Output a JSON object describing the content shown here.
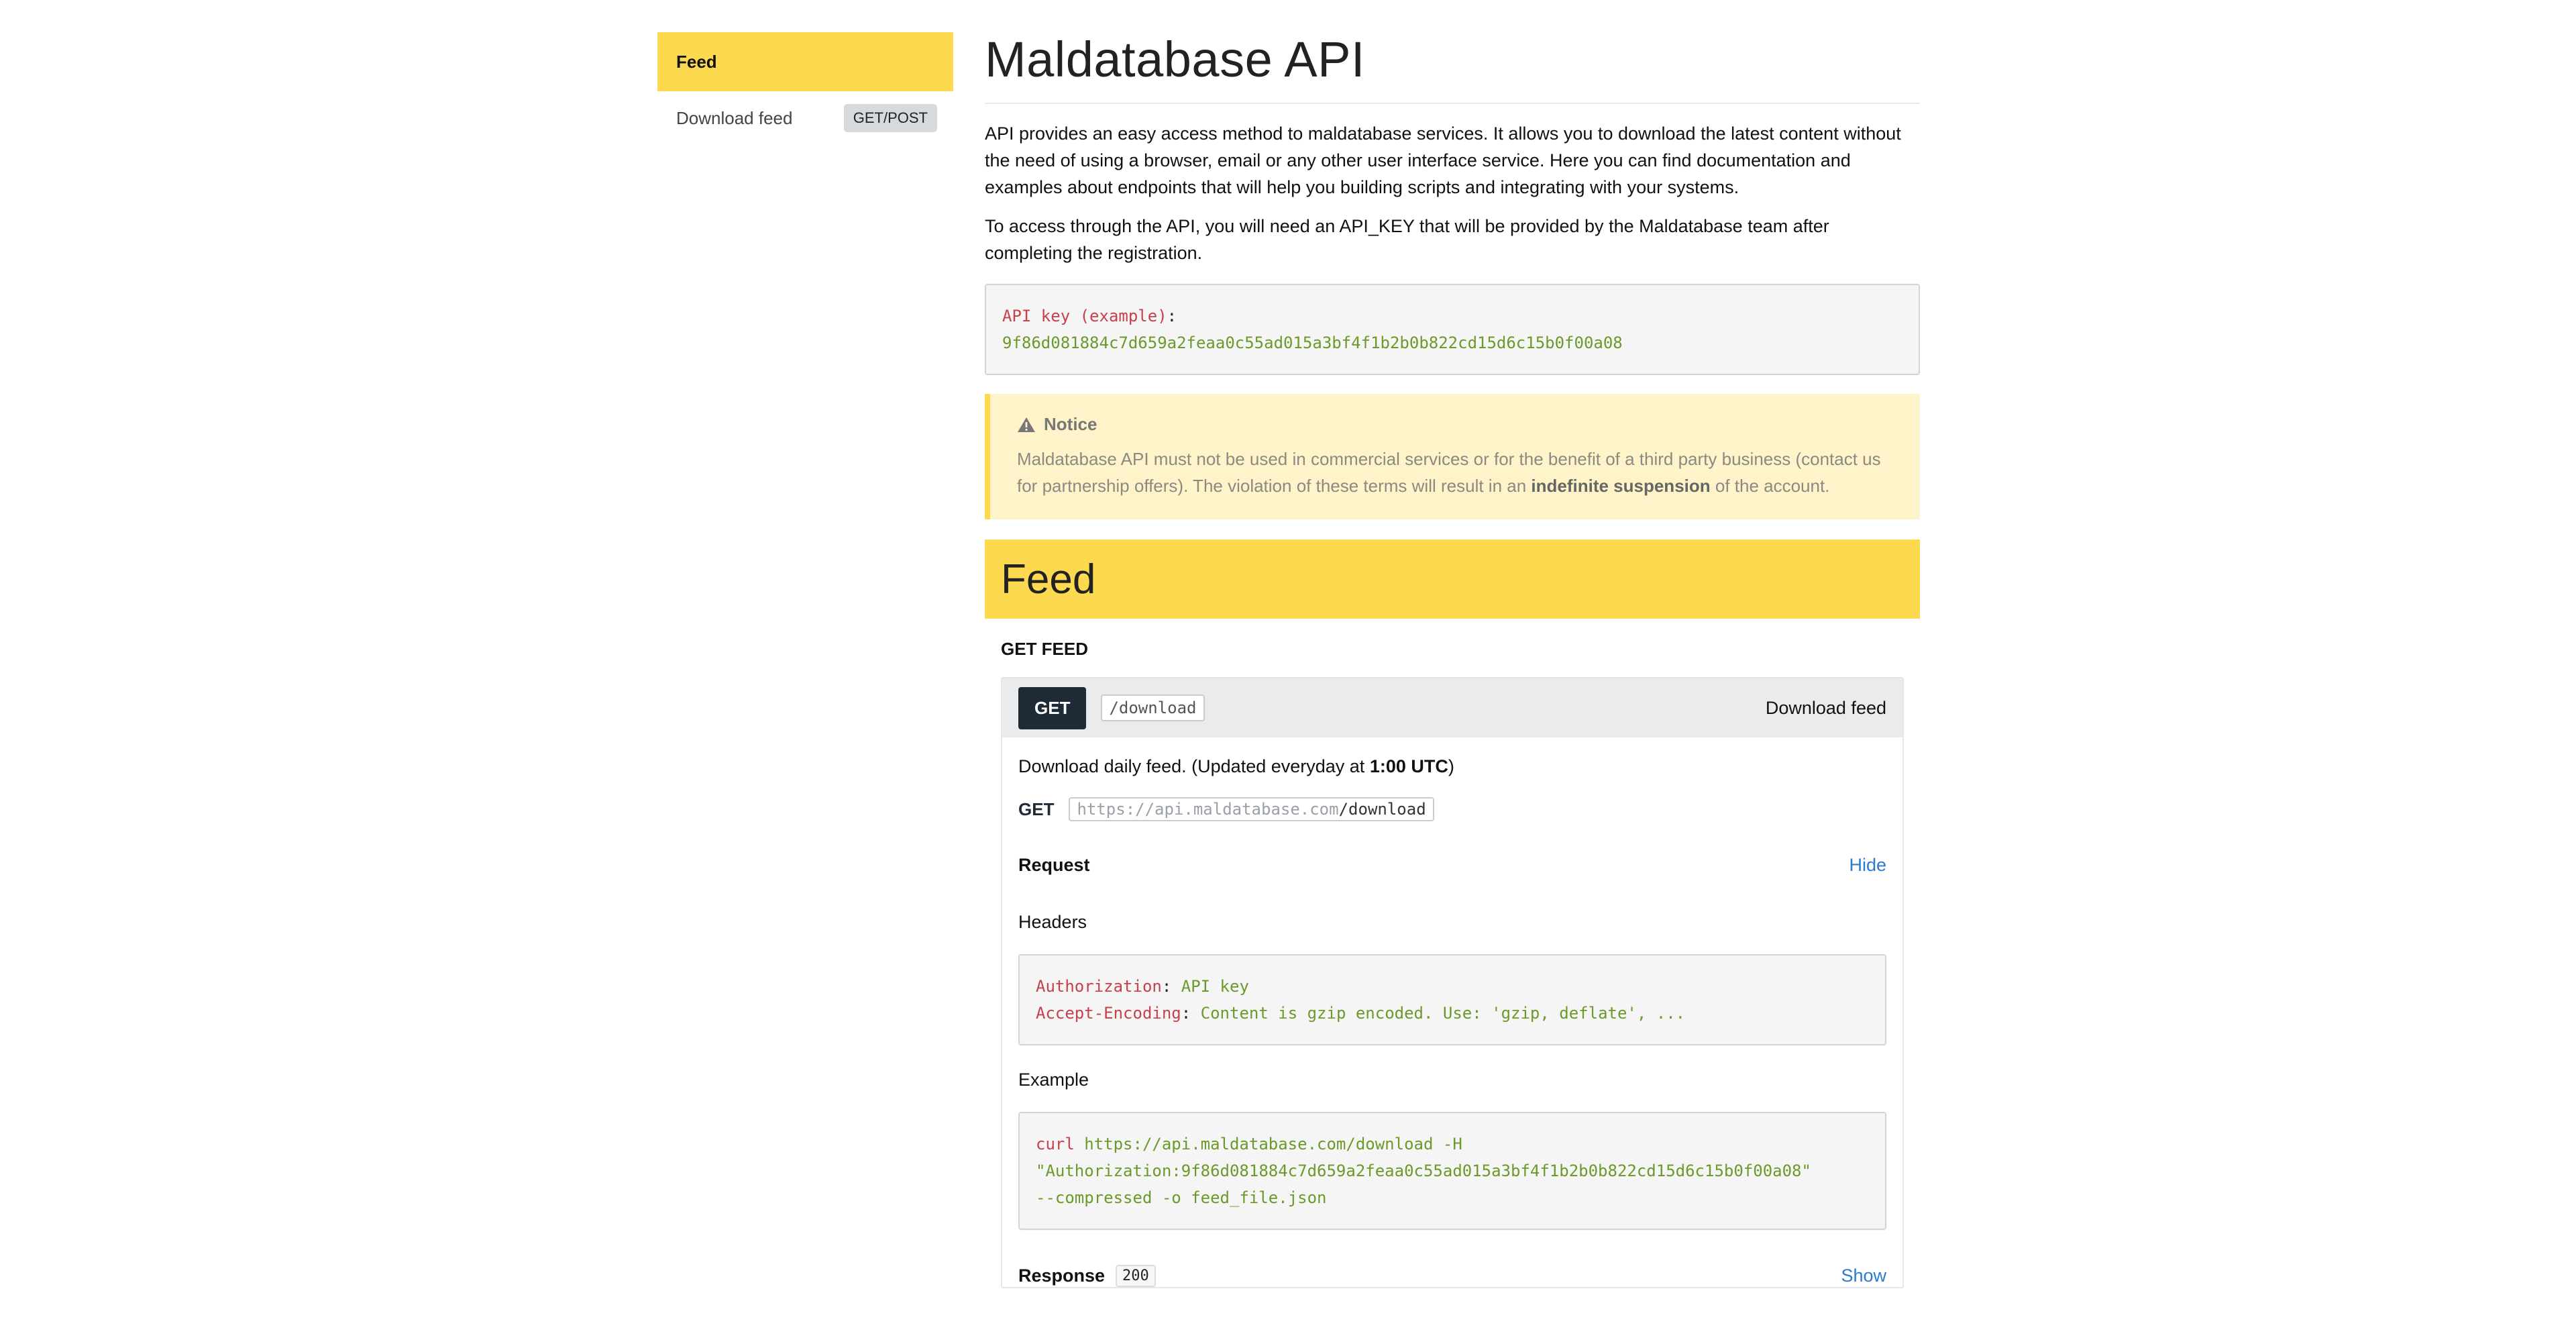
{
  "sidebar": {
    "active": "Feed",
    "items": [
      {
        "label": "Download feed",
        "badge": "GET/POST"
      }
    ]
  },
  "main": {
    "title": "Maldatabase API",
    "intro": "API provides an easy access method to maldatabase services. It allows you to download the latest content without the need of using a browser, email or any other user interface service. Here you can find documentation and examples about endpoints that will help you building scripts and integrating with your systems.",
    "access": "To access through the API, you will need an API_KEY that will be provided by the Maldatabase team after completing the registration.",
    "api_key_block": {
      "key": "API key (example)",
      "punct": ":",
      "value": "9f86d081884c7d659a2feaa0c55ad015a3bf4f1b2b0b822cd15d6c15b0f00a08"
    },
    "notice": {
      "title": "Notice",
      "text_before": "Maldatabase API must not be used in commercial services or for the benefit of a third party business (contact us for partnership offers). The violation of these terms will result in an ",
      "text_bold": "indefinite suspension",
      "text_after": " of the account."
    },
    "section": {
      "title": "Feed",
      "subtitle": "GET FEED",
      "endpoint": {
        "method": "GET",
        "path": "/download",
        "name": "Download feed",
        "desc_before": "Download daily feed. (Updated everyday at ",
        "desc_bold": "1:00 UTC",
        "desc_after": ")",
        "url_method": "GET",
        "url_base": "https://api.maldatabase.com",
        "url_path": "/download",
        "request_label": "Request",
        "request_toggle": "Hide",
        "headers_label": "Headers",
        "headers": [
          {
            "key": "Authorization",
            "value": "API key"
          },
          {
            "key": "Accept-Encoding",
            "value": "Content is gzip encoded. Use: 'gzip, deflate', ..."
          }
        ],
        "example_label": "Example",
        "example": {
          "cmd": "curl",
          "line1_rest": " https://api.maldatabase.com/download -H",
          "line2": "\"Authorization:9f86d081884c7d659a2feaa0c55ad015a3bf4f1b2b0b822cd15d6c15b0f00a08\"",
          "line3_flag": "--compressed -o",
          "line3_rest": " feed_file.json"
        },
        "response_label": "Response",
        "response_code": "200",
        "response_toggle": "Show"
      }
    }
  }
}
